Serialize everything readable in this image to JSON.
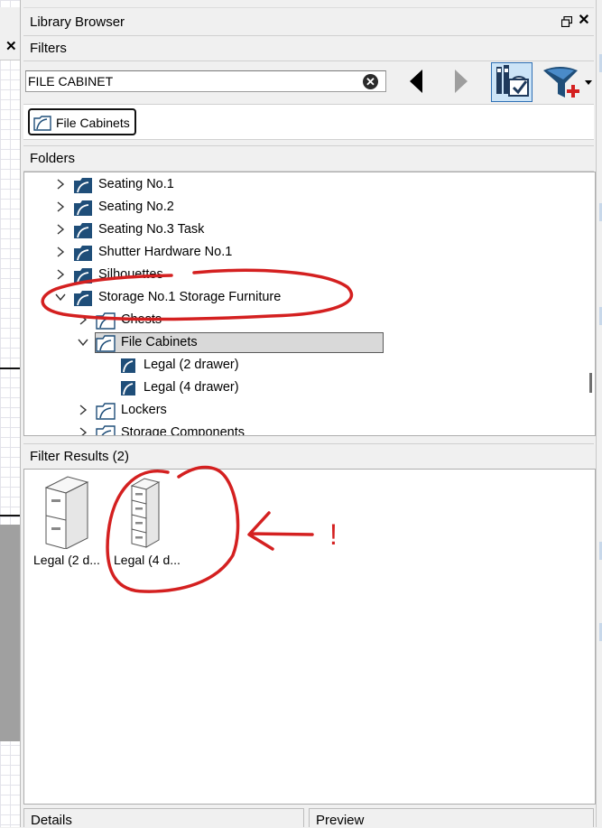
{
  "panel": {
    "title": "Library Browser"
  },
  "sections": {
    "filters": "Filters",
    "folders": "Folders",
    "filter_results": "Filter Results (2)",
    "details": "Details",
    "preview": "Preview"
  },
  "search": {
    "value": "FILE CABINET"
  },
  "chip": {
    "label": "File Cabinets"
  },
  "tree": {
    "rows": [
      {
        "label": "Seating No.1",
        "state": "collapsed"
      },
      {
        "label": "Seating No.2",
        "state": "collapsed"
      },
      {
        "label": "Seating No.3 Task",
        "state": "collapsed"
      },
      {
        "label": "Shutter Hardware No.1",
        "state": "collapsed"
      },
      {
        "label": "Silhouettes",
        "state": "collapsed"
      },
      {
        "label": "Storage No.1 Storage Furniture",
        "state": "expanded"
      },
      {
        "label": "Chests",
        "state": "collapsed"
      },
      {
        "label": "File Cabinets",
        "state": "expanded",
        "selected": true
      },
      {
        "label": "Legal (2 drawer)"
      },
      {
        "label": "Legal (4 drawer)"
      },
      {
        "label": "Lockers",
        "state": "collapsed"
      },
      {
        "label": "Storage Components",
        "state": "collapsed"
      }
    ]
  },
  "results": [
    {
      "label": "Legal (2 d..."
    },
    {
      "label": "Legal (4 d..."
    }
  ],
  "annotation": {
    "mark": "!",
    "color": "#d42020"
  },
  "colors": {
    "folder_icon": "#1f4e79",
    "selection_border": "#2e6fb4",
    "accent_red": "#d42020"
  }
}
